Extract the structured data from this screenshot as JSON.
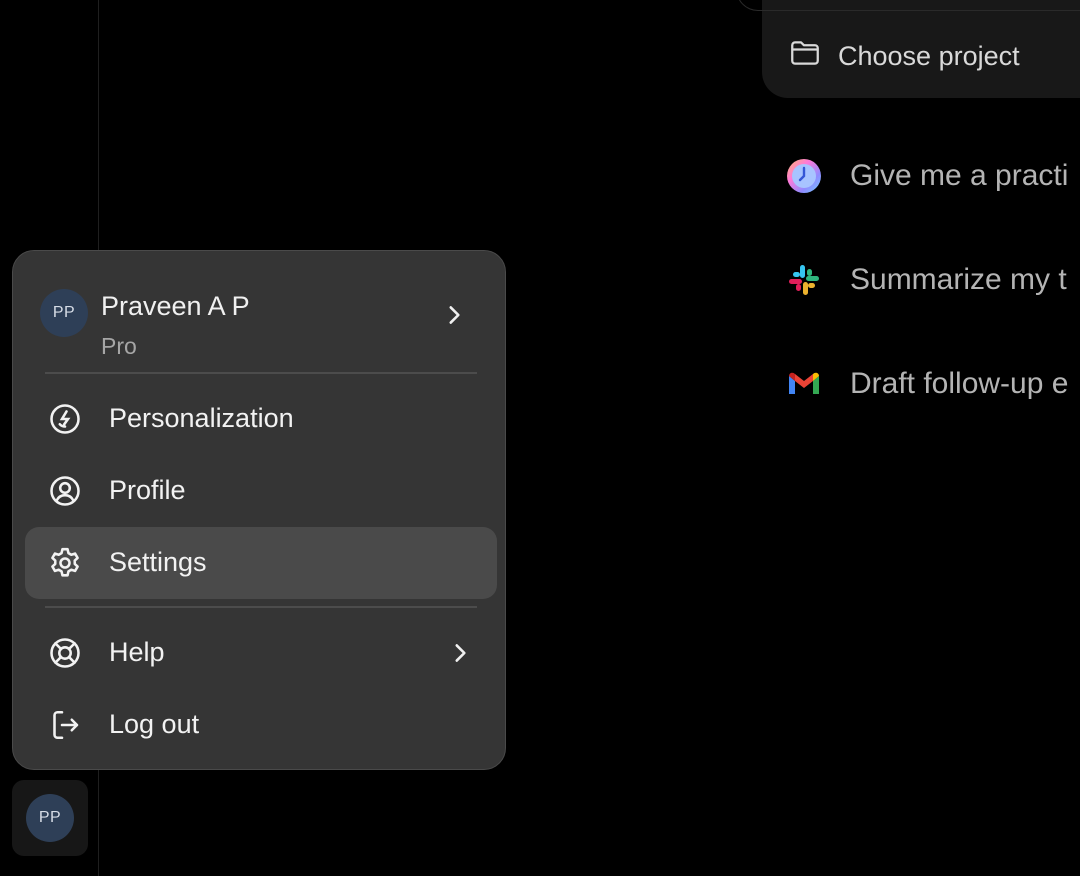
{
  "composer": {
    "choose_project_label": "Choose project",
    "folder_icon": "folder-icon"
  },
  "suggestions": [
    {
      "label": "Give me a practi",
      "icon": "clock-app-icon"
    },
    {
      "label": "Summarize my t",
      "icon": "slack-icon"
    },
    {
      "label": "Draft follow-up e",
      "icon": "gmail-icon"
    }
  ],
  "account_menu": {
    "user": {
      "initials": "PP",
      "name": "Praveen A P",
      "plan": "Pro"
    },
    "items": [
      {
        "label": "Personalization",
        "icon": "personalization-icon",
        "has_submenu": false
      },
      {
        "label": "Profile",
        "icon": "profile-icon",
        "has_submenu": false
      },
      {
        "label": "Settings",
        "icon": "gear-icon",
        "has_submenu": false,
        "highlighted": true
      },
      {
        "label": "Help",
        "icon": "lifebuoy-icon",
        "has_submenu": true
      },
      {
        "label": "Log out",
        "icon": "logout-icon",
        "has_submenu": false
      }
    ]
  },
  "sidebar": {
    "avatar_initials": "PP"
  },
  "colors": {
    "background": "#000000",
    "menu_background": "#353535",
    "menu_highlight": "#4a4a4a",
    "avatar_background": "#2e3f57",
    "text_primary": "#f2f2f2",
    "text_secondary": "#a6a6a6",
    "suggestion_text": "#b4b4b4"
  }
}
